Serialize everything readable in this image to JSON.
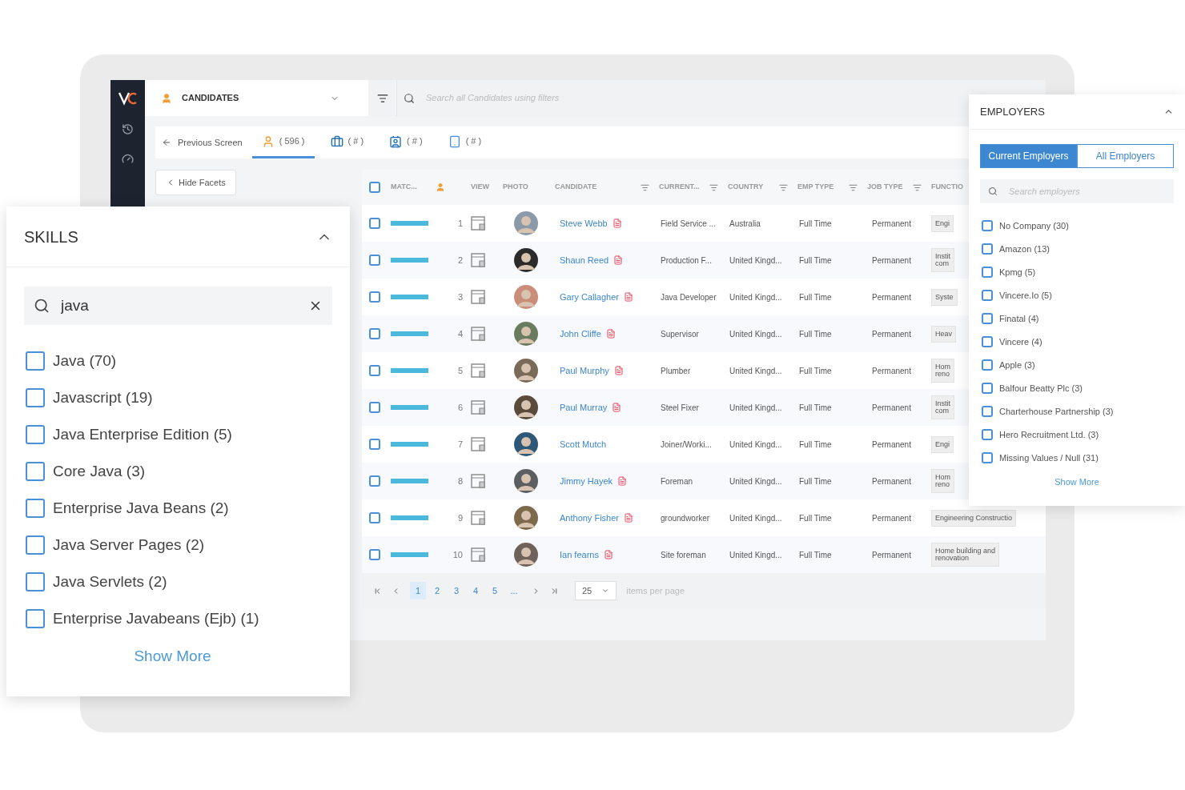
{
  "header": {
    "module": "CANDIDATES",
    "search_placeholder": "Search all Candidates using filters"
  },
  "nav": {
    "back": "Previous Screen",
    "tabs": [
      {
        "label": "( 596 )",
        "selected": true
      },
      {
        "label": "( # )",
        "selected": false
      },
      {
        "label": "( # )",
        "selected": false
      },
      {
        "label": "( # )",
        "selected": false
      }
    ]
  },
  "hide_facets": "Hide Facets",
  "table": {
    "header_checked": false,
    "columns": [
      {
        "label": "MATC...",
        "filter": false
      },
      {
        "label": "VIEW",
        "filter": false
      },
      {
        "label": "PHOTO",
        "filter": false
      },
      {
        "label": "CANDIDATE",
        "filter": true
      },
      {
        "label": "CURRENT...",
        "filter": true
      },
      {
        "label": "COUNTRY",
        "filter": true
      },
      {
        "label": "EMP TYPE",
        "filter": true
      },
      {
        "label": "JOB TYPE",
        "filter": true
      },
      {
        "label": "FUNCTIO"
      }
    ],
    "rows": [
      {
        "checked": false,
        "level": 1,
        "number": "1",
        "name": "Steve Webb",
        "cv": true,
        "current": "Field Service ...",
        "country": "Australia",
        "emp_type": "Full Time",
        "job_type": "Permanent",
        "function": "Engi"
      },
      {
        "checked": false,
        "level": 1,
        "number": "2",
        "name": "Shaun Reed",
        "cv": true,
        "current": "Production F...",
        "country": "United Kingd...",
        "emp_type": "Full Time",
        "job_type": "Permanent",
        "function": "Instit\ncom"
      },
      {
        "checked": false,
        "level": 1,
        "number": "3",
        "name": "Gary Callagher",
        "cv": true,
        "current": "Java Developer",
        "country": "United Kingd...",
        "emp_type": "Full Time",
        "job_type": "Permanent",
        "function": "Syste"
      },
      {
        "checked": false,
        "level": 1,
        "number": "4",
        "name": "John Cliffe",
        "cv": true,
        "current": "Supervisor",
        "country": "United Kingd...",
        "emp_type": "Full Time",
        "job_type": "Permanent",
        "function": "Heav"
      },
      {
        "checked": false,
        "level": 1,
        "number": "5",
        "name": "Paul Murphy",
        "cv": true,
        "current": "Plumber",
        "country": "United Kingd...",
        "emp_type": "Full Time",
        "job_type": "Permanent",
        "function": "Hom\nreno"
      },
      {
        "checked": false,
        "level": 1,
        "number": "6",
        "name": "Paul Murray",
        "cv": true,
        "current": "Steel Fixer",
        "country": "United Kingd...",
        "emp_type": "Full Time",
        "job_type": "Permanent",
        "function": "Instit\ncom"
      },
      {
        "checked": false,
        "level": 1,
        "number": "7",
        "name": "Scott Mutch",
        "cv": false,
        "current": "Joiner/Worki...",
        "country": "United Kingd...",
        "emp_type": "Full Time",
        "job_type": "Permanent",
        "function": "Engi"
      },
      {
        "checked": false,
        "level": 1,
        "number": "8",
        "name": "Jimmy Hayek",
        "cv": true,
        "current": "Foreman",
        "country": "United Kingd...",
        "emp_type": "Full Time",
        "job_type": "Permanent",
        "function": "Hom\nreno"
      },
      {
        "checked": false,
        "level": 1,
        "number": "9",
        "name": "Anthony Fisher",
        "cv": true,
        "current": "groundworker",
        "country": "United Kingd...",
        "emp_type": "Full Time",
        "job_type": "Permanent",
        "function": "Engineering Constructio"
      },
      {
        "checked": false,
        "level": 1,
        "number": "10",
        "name": "Ian fearns",
        "cv": true,
        "current": "Site foreman",
        "country": "United Kingd...",
        "emp_type": "Full Time",
        "job_type": "Permanent",
        "function": "Home building and\nrenovation"
      }
    ]
  },
  "pagination": {
    "pages": [
      {
        "label": "1",
        "selected": true
      },
      {
        "label": "2",
        "selected": false
      },
      {
        "label": "3",
        "selected": false
      },
      {
        "label": "4",
        "selected": false
      },
      {
        "label": "5",
        "selected": false
      },
      {
        "label": "...",
        "selected": false
      }
    ],
    "per_page": "25",
    "per_page_label": "items per page"
  },
  "skills": {
    "title": "SKILLS",
    "expanded": true,
    "search": "java",
    "items": [
      {
        "label": "Java (70)",
        "checked": false
      },
      {
        "label": "Javascript (19)",
        "checked": false
      },
      {
        "label": "Java Enterprise Edition (5)",
        "checked": false
      },
      {
        "label": "Core Java (3)",
        "checked": false
      },
      {
        "label": "Enterprise Java Beans (2)",
        "checked": false
      },
      {
        "label": "Java Server Pages (2)",
        "checked": false
      },
      {
        "label": "Java Servlets (2)",
        "checked": false
      },
      {
        "label": "Enterprise Javabeans (Ejb) (1)",
        "checked": false
      }
    ],
    "show_more": "Show More"
  },
  "employers": {
    "title": "EMPLOYERS",
    "expanded": true,
    "toggle": [
      {
        "label": "Current Employers",
        "selected": true
      },
      {
        "label": "All Employers",
        "selected": false
      }
    ],
    "search_placeholder": "Search employers",
    "items": [
      {
        "label": "No Company (30)",
        "checked": false
      },
      {
        "label": "Amazon (13)",
        "checked": false
      },
      {
        "label": "Kpmg (5)",
        "checked": false
      },
      {
        "label": "Vincere.Io (5)",
        "checked": false
      },
      {
        "label": "Finatal (4)",
        "checked": false
      },
      {
        "label": "Vincere (4)",
        "checked": false
      },
      {
        "label": "Apple (3)",
        "checked": false
      },
      {
        "label": "Balfour Beatty Plc (3)",
        "checked": false
      },
      {
        "label": "Charterhouse Partnership (3)",
        "checked": false
      },
      {
        "label": "Hero Recruitment Ltd. (3)",
        "checked": false
      },
      {
        "label": "Missing Values / Null (31)",
        "checked": false
      }
    ],
    "show_more": "Show More"
  }
}
